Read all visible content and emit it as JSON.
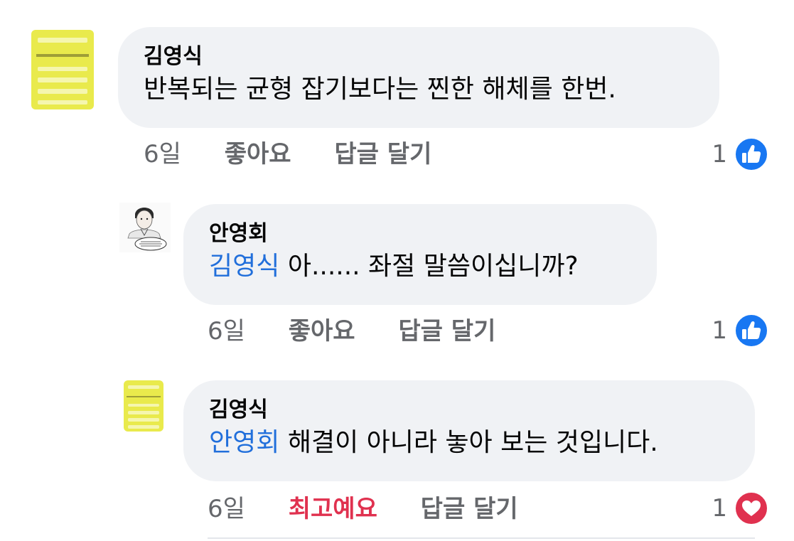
{
  "comments": [
    {
      "author": "김영식",
      "mention": "",
      "text": "반복되는 균형 잡기보다는 찐한 해체를 한번.",
      "time": "6일",
      "like_action": "좋아요",
      "reply_action": "답글 달기",
      "reaction_count": "1",
      "reaction_type": "like-icon",
      "reaction_color": "#1877f2",
      "avatar": "book-cover-avatar"
    },
    {
      "author": "안영회",
      "mention": "김영식",
      "text": " 아...... 좌절 말씀이십니까?",
      "time": "6일",
      "like_action": "좋아요",
      "reply_action": "답글 달기",
      "reaction_count": "1",
      "reaction_type": "like-icon",
      "reaction_color": "#1877f2",
      "avatar": "illustration-avatar"
    },
    {
      "author": "김영식",
      "mention": "안영회",
      "text": " 해결이 아니라 놓아 보는 것입니다.",
      "time": "6일",
      "like_action": "최고예요",
      "reply_action": "답글 달기",
      "reaction_count": "1",
      "reaction_type": "love-icon",
      "reaction_color": "#e0314f",
      "avatar": "book-cover-avatar"
    }
  ],
  "colors": {
    "bubble_bg": "#f0f2f5",
    "mention": "#216fdb",
    "meta_text": "#65676b",
    "love_action": "#e0314f"
  }
}
